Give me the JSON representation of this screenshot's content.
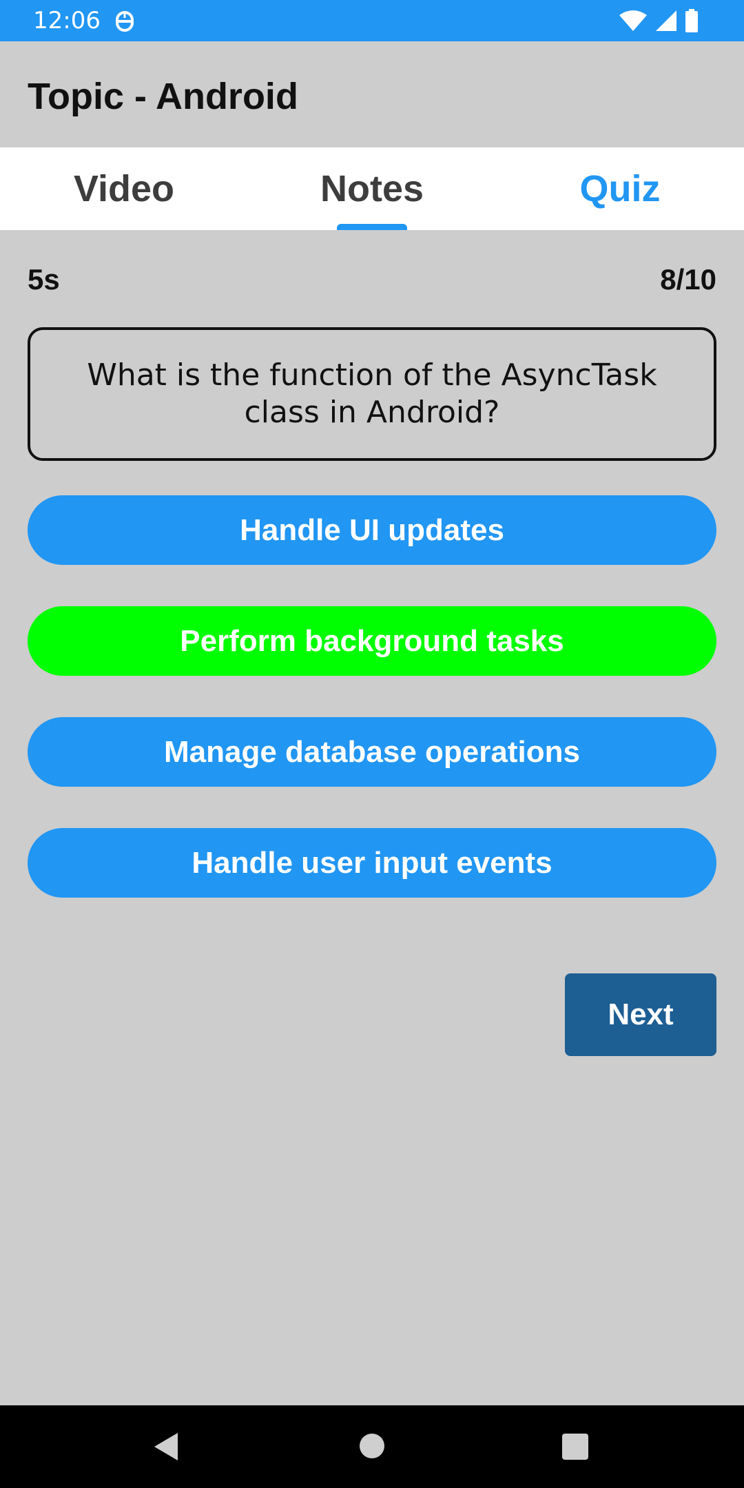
{
  "status_bar": {
    "time": "12:06",
    "icons": [
      "notification-icon",
      "wifi-icon",
      "signal-icon",
      "battery-icon"
    ],
    "color": "#2196f3"
  },
  "header": {
    "title": "Topic - Android"
  },
  "tabs": [
    {
      "label": "Video",
      "active": false
    },
    {
      "label": "Notes",
      "active": false
    },
    {
      "label": "Quiz",
      "active": true
    }
  ],
  "quiz": {
    "timer": "5s",
    "progress": "8/10",
    "question": "What is the function of the AsyncTask class in Android?",
    "options": [
      {
        "label": "Handle UI updates",
        "state": "default"
      },
      {
        "label": "Perform background tasks",
        "state": "correct"
      },
      {
        "label": "Manage database operations",
        "state": "default"
      },
      {
        "label": "Handle user input events",
        "state": "default"
      }
    ],
    "next_label": "Next"
  },
  "colors": {
    "accent": "#2196f3",
    "correct": "#00ff00",
    "next_button": "#1d5e93",
    "background": "#cdcdcd"
  },
  "nav_bar": {
    "icons": [
      "back-icon",
      "home-icon",
      "recents-icon"
    ]
  }
}
